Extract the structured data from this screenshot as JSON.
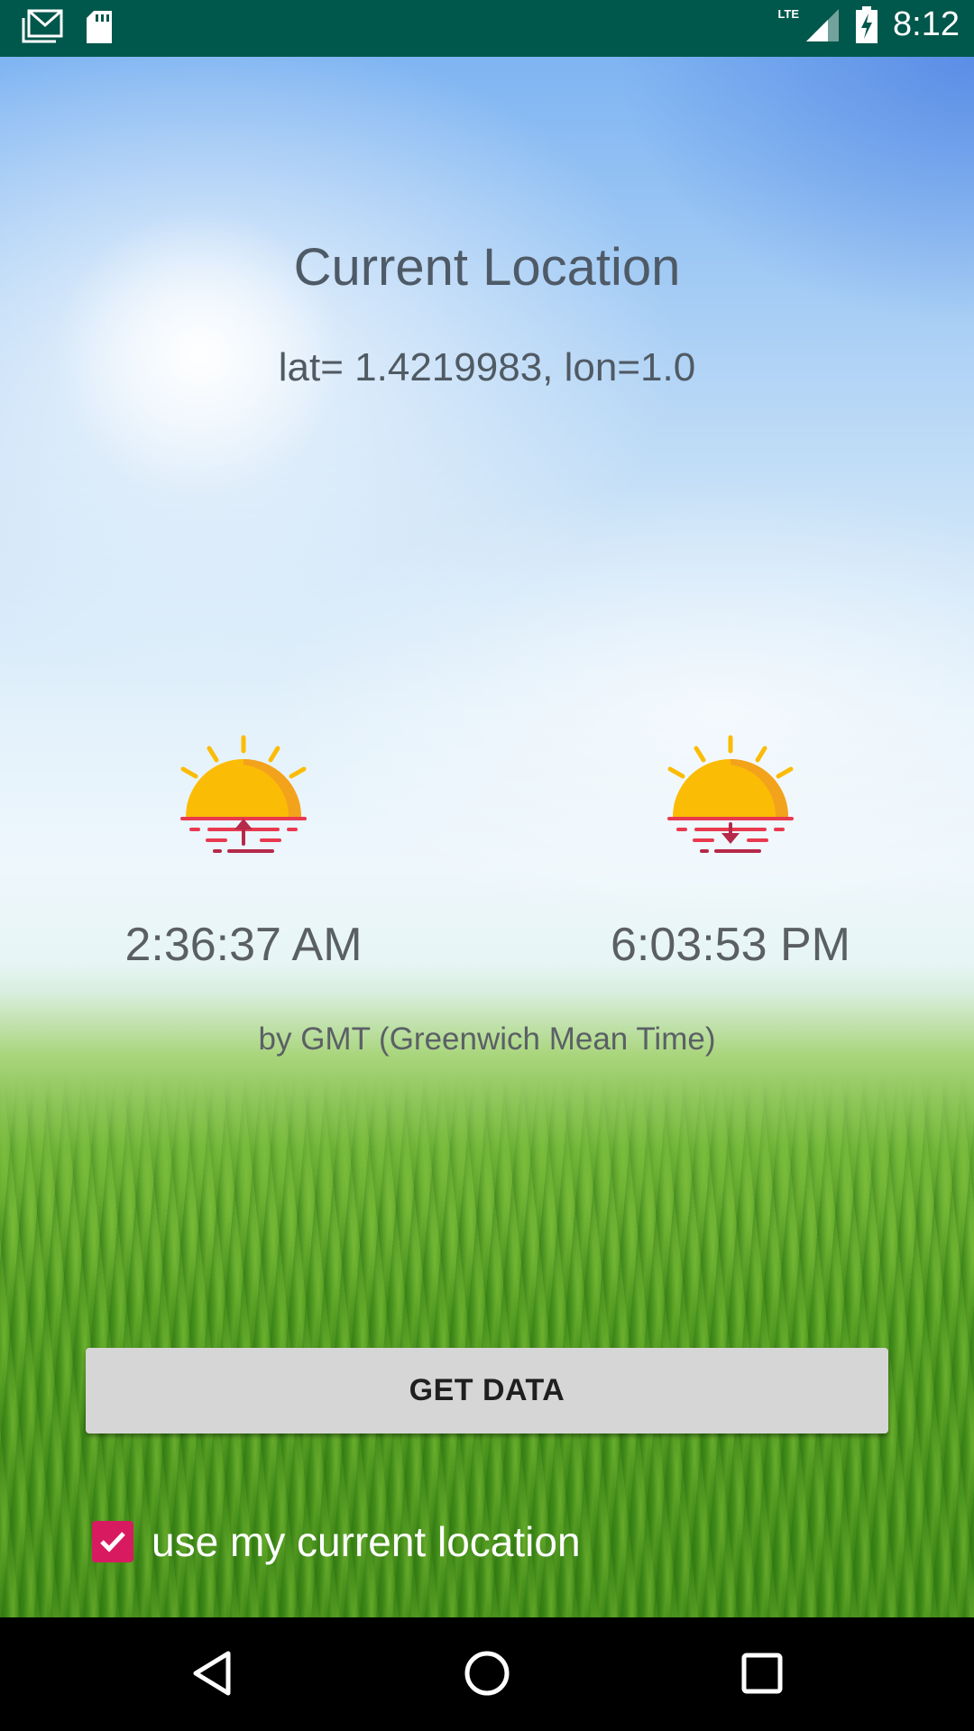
{
  "status_bar": {
    "time": "8:12",
    "network": "LTE",
    "icons": [
      "gmail-icon",
      "sd-card-icon",
      "signal-icon",
      "battery-charging-icon"
    ]
  },
  "main": {
    "title": "Current Location",
    "coordinates": "lat= 1.4219983, lon=1.0",
    "sunrise_time": "2:36:37 AM",
    "sunset_time": "6:03:53 PM",
    "timezone_note": "by GMT  (Greenwich Mean Time)",
    "get_data_label": "GET DATA",
    "use_location_label": "use my current location",
    "use_location_checked": true
  },
  "colors": {
    "status_bar": "#00574b",
    "accent": "#d81b60",
    "sun": "#fbbc05",
    "horizon": "#e8394f"
  },
  "nav_bar": {
    "icons": [
      "back-icon",
      "home-icon",
      "recents-icon"
    ]
  }
}
